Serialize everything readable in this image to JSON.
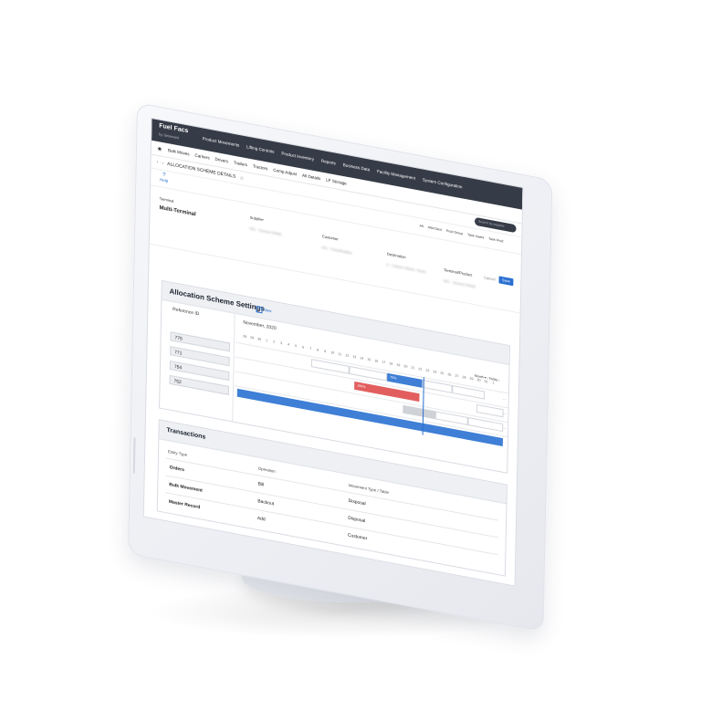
{
  "app": {
    "brand": "Fuel Facs",
    "brand_sub": "by Seismant"
  },
  "main_nav": [
    "Product Movements",
    "Lifting Controls",
    "Product Inventory",
    "Reports",
    "Business Data",
    "Facility Management",
    "System Configuration"
  ],
  "sub_nav": [
    "Bulk Moves",
    "Carriers",
    "Drivers",
    "Trailers",
    "Tractors",
    "Comp Adjust",
    "All Details",
    "LF Storage"
  ],
  "page": {
    "title": "ALLOCATION SCHEME DETAILS",
    "search_placeholder": "Search by supplier"
  },
  "toolbar": {
    "help_label": "Help",
    "tabs": [
      "Alt",
      "Allot Dest",
      "Prod Group",
      "Tank Invent",
      "Tank Prod"
    ]
  },
  "header_form": {
    "terminal_label": "Terminal",
    "terminal_value": "Multi-Terminal",
    "supplier_label": "Supplier",
    "supplier_value": "001 - Sunoco Retail",
    "customer_label": "Customer",
    "customer_value": "001 - PetroRetailer",
    "destination_label": "Destination",
    "destination_value": "0 - Carbon Street, Texas",
    "terminal_product_label": "Terminal/Product",
    "terminal_product_value": "001 - Sunoco Retail",
    "cancel_label": "Cancel",
    "save_label": "Save"
  },
  "allocation": {
    "title": "Allocation Scheme Settings",
    "new_label": "New",
    "ref_header": "Reference ID",
    "month": "November, 2020",
    "days": [
      "28",
      "29",
      "30",
      "1",
      "2",
      "3",
      "4",
      "5",
      "6",
      "7",
      "8",
      "9",
      "10",
      "11",
      "12",
      "13",
      "14",
      "15",
      "16",
      "17",
      "18",
      "19",
      "20",
      "21",
      "22",
      "23",
      "24",
      "25",
      "26",
      "27",
      "28",
      "29",
      "30",
      "31",
      "1"
    ],
    "controls": "Month  ▾   ‹  Today  ›",
    "rows": [
      {
        "id": "775",
        "bars": [
          {
            "start": 0.28,
            "end": 0.42,
            "style": "white",
            "label": ""
          },
          {
            "start": 0.42,
            "end": 0.56,
            "style": "white",
            "label": ""
          },
          {
            "start": 0.56,
            "end": 0.69,
            "style": "blue",
            "label": "70%"
          },
          {
            "start": 0.69,
            "end": 0.8,
            "style": "white",
            "label": ""
          },
          {
            "start": 0.8,
            "end": 0.92,
            "style": "white",
            "label": ""
          }
        ]
      },
      {
        "id": "771",
        "bars": [
          {
            "start": 0.44,
            "end": 0.68,
            "style": "red",
            "label": "100%"
          },
          {
            "start": 0.89,
            "end": 0.99,
            "style": "white",
            "label": ""
          }
        ]
      },
      {
        "id": "754",
        "bars": [
          {
            "start": 0.62,
            "end": 0.74,
            "style": "gray",
            "label": ""
          },
          {
            "start": 0.74,
            "end": 0.86,
            "style": "white",
            "label": ""
          },
          {
            "start": 0.86,
            "end": 0.99,
            "style": "white",
            "label": ""
          }
        ]
      },
      {
        "id": "752",
        "bars": [
          {
            "start": 0.01,
            "end": 0.99,
            "style": "blue",
            "label": ""
          }
        ]
      }
    ]
  },
  "transactions": {
    "title": "Transactions",
    "columns": [
      "Entity Type",
      "Operation",
      "Movement Type / Table"
    ],
    "rows": [
      {
        "entity": "Orders",
        "operation": "Bill",
        "movement": "Disposal"
      },
      {
        "entity": "Bulk Movement",
        "operation": "Backout",
        "movement": "Disposal"
      },
      {
        "entity": "Master Record",
        "operation": "Add",
        "movement": "Customer"
      }
    ]
  },
  "colors": {
    "accent": "#2a6fd1",
    "topbar": "#363c47",
    "bar_blue": "#3f7fd6",
    "bar_red": "#e25e5e"
  }
}
